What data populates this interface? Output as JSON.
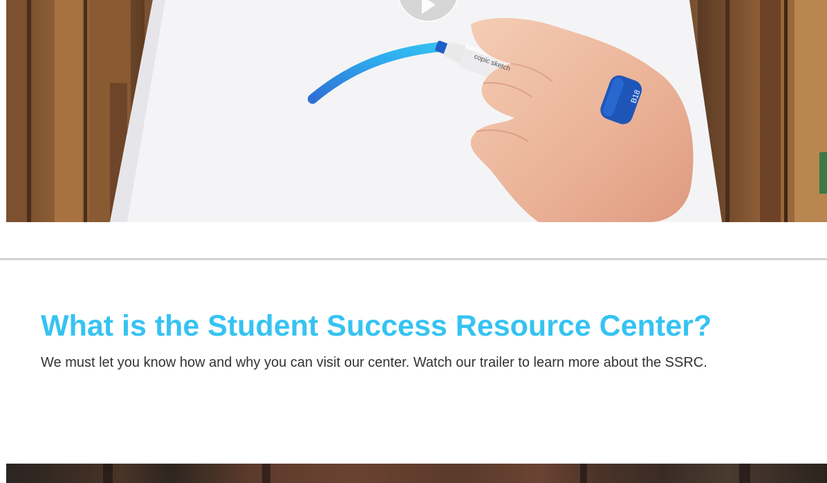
{
  "top_video": {
    "play_label": "Play video",
    "marker_text": "copic sketch",
    "marker_cap_text": "B18"
  },
  "section": {
    "title": "What is the Student Success Resource Center?",
    "body": "We must let you know how and why you can visit our center. Watch our trailer to learn more about the SSRC."
  },
  "colors": {
    "title": "#36c3f2",
    "body_text": "#333333",
    "divider": "#d2d2d2"
  }
}
